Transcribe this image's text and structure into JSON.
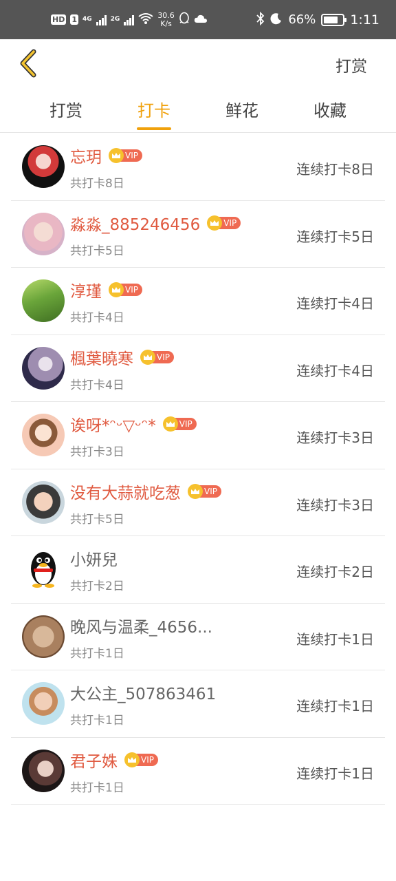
{
  "status_bar": {
    "hd": "HD",
    "sim": "1",
    "net1": "4G",
    "net2": "2G",
    "speed_value": "30.6",
    "speed_unit": "K/s",
    "battery": "66%",
    "time": "1:11",
    "icons": [
      "hd-icon",
      "signal-icon",
      "wifi-icon",
      "qq-icon",
      "cloud-icon",
      "bluetooth-icon",
      "moon-icon",
      "battery-icon"
    ]
  },
  "header": {
    "action": "打赏"
  },
  "tabs": [
    {
      "label": "打赏",
      "active": false
    },
    {
      "label": "打卡",
      "active": true
    },
    {
      "label": "鲜花",
      "active": false
    },
    {
      "label": "收藏",
      "active": false
    }
  ],
  "vip_label": "VIP",
  "users": [
    {
      "name": "忘玥",
      "vip": true,
      "total": "共打卡8日",
      "streak": "连续打卡8日"
    },
    {
      "name": "淼淼_885246456",
      "vip": true,
      "total": "共打卡5日",
      "streak": "连续打卡5日"
    },
    {
      "name": "淳瑾",
      "vip": true,
      "total": "共打卡4日",
      "streak": "连续打卡4日"
    },
    {
      "name": "楓葉曉寒",
      "vip": true,
      "total": "共打卡4日",
      "streak": "连续打卡4日"
    },
    {
      "name": "诶呀*ᵔᵕ▽ᵕᵔ*",
      "vip": true,
      "total": "共打卡3日",
      "streak": "连续打卡3日"
    },
    {
      "name": "没有大蒜就吃葱",
      "vip": true,
      "total": "共打卡5日",
      "streak": "连续打卡3日"
    },
    {
      "name": "小妍兒",
      "vip": false,
      "total": "共打卡2日",
      "streak": "连续打卡2日"
    },
    {
      "name": "晚风与温柔_4656...",
      "vip": false,
      "total": "共打卡1日",
      "streak": "连续打卡1日"
    },
    {
      "name": "大公主_507863461",
      "vip": false,
      "total": "共打卡1日",
      "streak": "连续打卡1日"
    },
    {
      "name": "君子姝",
      "vip": true,
      "total": "共打卡1日",
      "streak": "连续打卡1日"
    }
  ],
  "colors": {
    "accent": "#f0a10c",
    "vip_name": "#e05a40",
    "status_bar": "#555555"
  }
}
